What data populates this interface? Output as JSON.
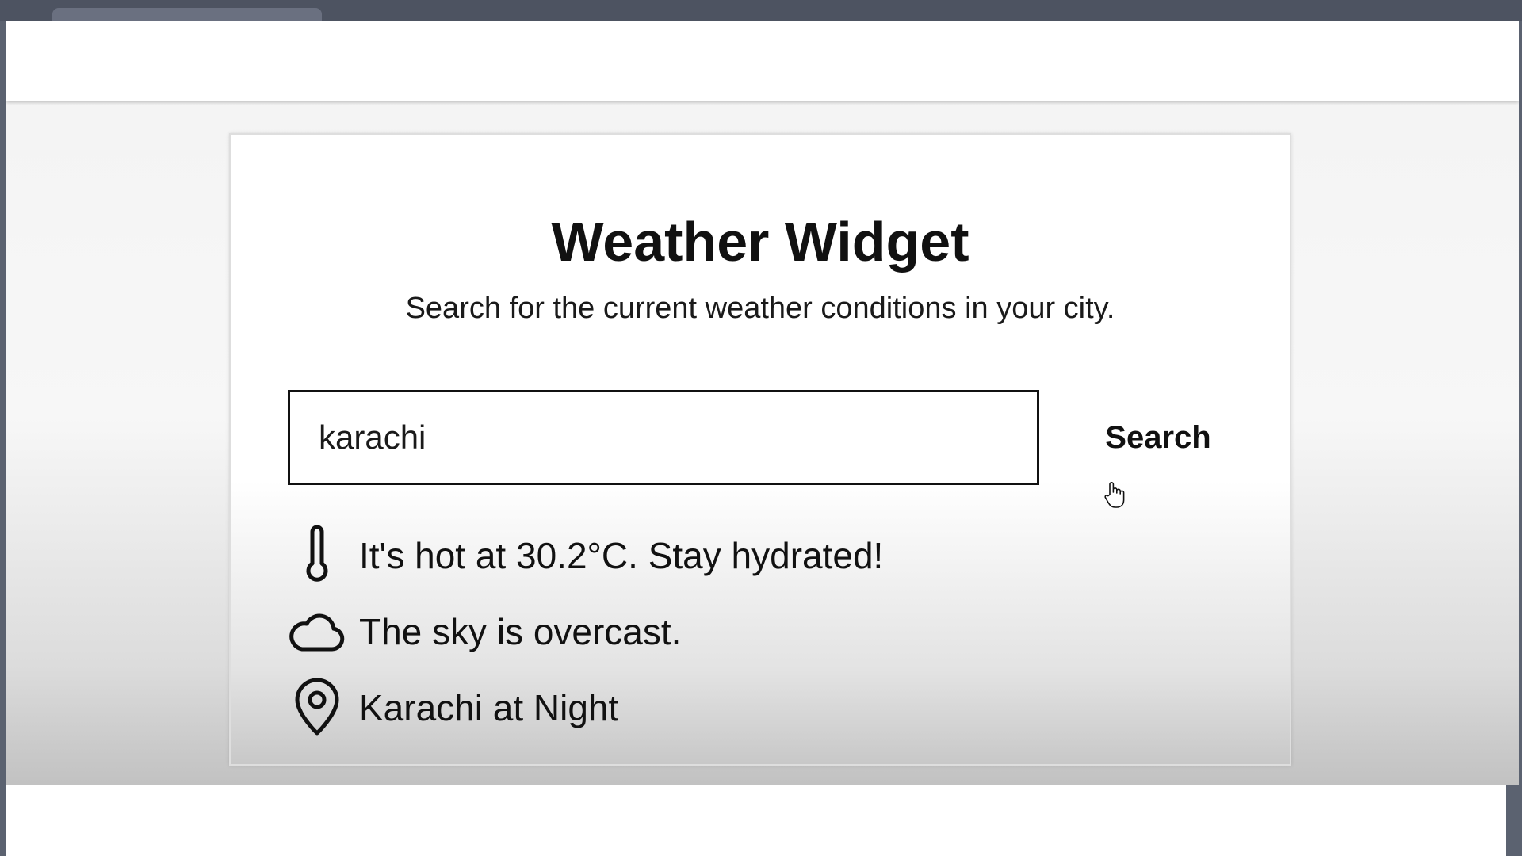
{
  "app": {
    "title": "Weather Widget",
    "subtitle": "Search for the current weather conditions in your city."
  },
  "search": {
    "value": "karachi",
    "button_label": "Search"
  },
  "results": [
    {
      "icon": "thermometer-icon",
      "text": "It's hot at 30.2°C. Stay hydrated!"
    },
    {
      "icon": "cloud-icon",
      "text": "The sky is overcast."
    },
    {
      "icon": "location-pin-icon",
      "text": "Karachi at Night"
    }
  ],
  "colors": {
    "text": "#111111",
    "input_border": "#111111",
    "card_border": "#dedede",
    "browser_chrome": "#4d5361"
  }
}
